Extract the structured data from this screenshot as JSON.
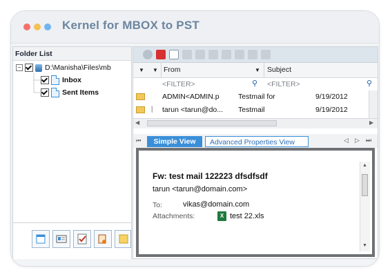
{
  "window": {
    "title": "Kernel for MBOX to PST"
  },
  "folder_list": {
    "header": "Folder List",
    "root": {
      "label": "D:\\Manisha\\Files\\mb",
      "checked": true
    },
    "items": [
      {
        "label": "Inbox",
        "checked": true
      },
      {
        "label": "Sent Items",
        "checked": true
      }
    ]
  },
  "mail_list": {
    "columns": {
      "from": "From",
      "subject": "Subject"
    },
    "filter_placeholder": "<FILTER>",
    "rows": [
      {
        "from": "ADMIN<ADMIN.p",
        "subject": "Testmail for",
        "date": "9/19/2012",
        "attachment": false
      },
      {
        "from": "tarun <tarun@do...",
        "subject": "Testmail",
        "date": "9/19/2012",
        "attachment": true
      }
    ]
  },
  "view_tabs": {
    "simple": "Simple View",
    "advanced": "Advanced Properties View"
  },
  "preview": {
    "subject": "Fw: test mail 122223 dfsdfsdf",
    "from": "tarun <tarun@domain.com>",
    "to_label": "To:",
    "to": "vikas@domain.com",
    "attachments_label": "Attachments:",
    "attachment": "test 22.xls"
  },
  "colors": {
    "accent_blue": "#3a8fd8",
    "title_text": "#6c86a0",
    "dot_red": "#f56f6f",
    "dot_yellow": "#f5c056",
    "dot_blue": "#6fb6f0"
  }
}
